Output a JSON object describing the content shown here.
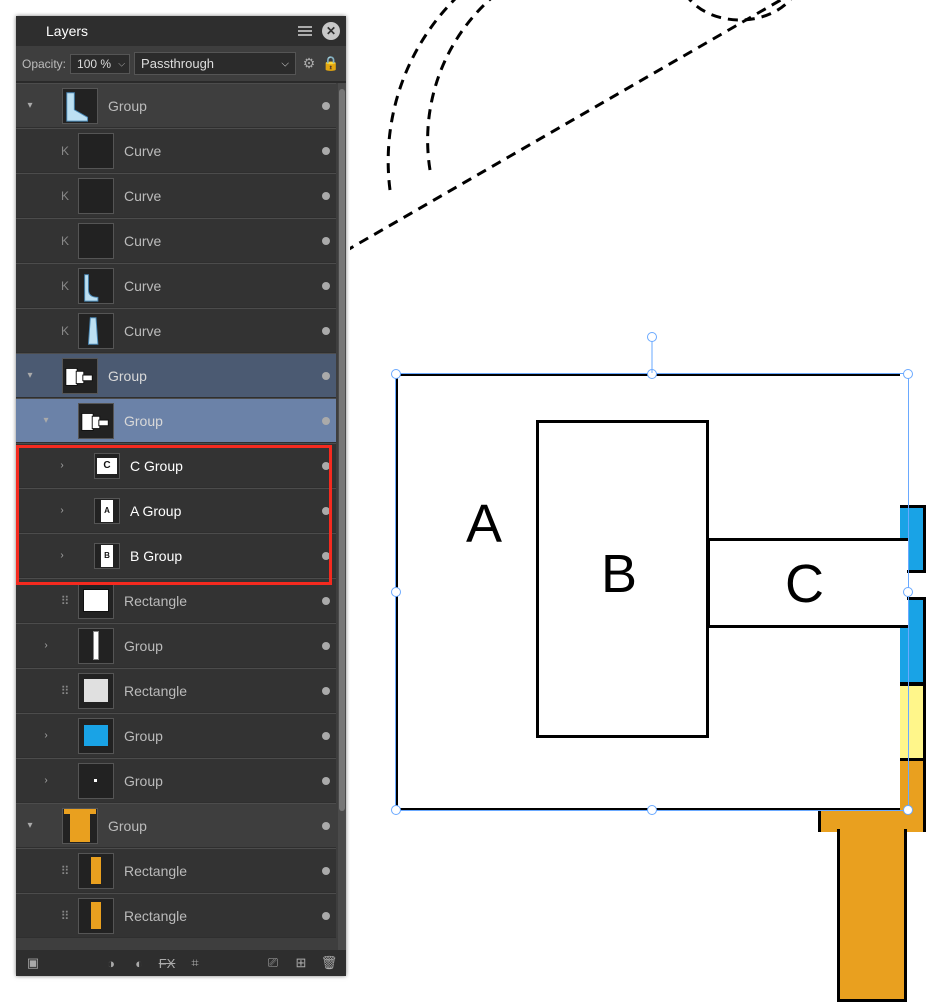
{
  "panel": {
    "title": "Layers",
    "opacity_label": "Opacity:",
    "opacity_value": "100 %",
    "blend_mode": "Passthrough"
  },
  "layers": [
    {
      "id": "grp0",
      "depth": 0,
      "kind": "group",
      "label": "Group",
      "expander": "▾",
      "sel": "",
      "thumb": {
        "type": "boot"
      },
      "icon": ""
    },
    {
      "id": "cv1",
      "depth": 1,
      "kind": "curve",
      "label": "Curve",
      "expander": "",
      "sel": "dark",
      "thumb": {
        "type": "blank"
      },
      "icon": "K"
    },
    {
      "id": "cv2",
      "depth": 1,
      "kind": "curve",
      "label": "Curve",
      "expander": "",
      "sel": "dark",
      "thumb": {
        "type": "blank"
      },
      "icon": "K"
    },
    {
      "id": "cv3",
      "depth": 1,
      "kind": "curve",
      "label": "Curve",
      "expander": "",
      "sel": "dark",
      "thumb": {
        "type": "blank"
      },
      "icon": "K"
    },
    {
      "id": "cv4",
      "depth": 1,
      "kind": "curve",
      "label": "Curve",
      "expander": "",
      "sel": "dark",
      "thumb": {
        "type": "curve-lb"
      },
      "icon": "K"
    },
    {
      "id": "cv5",
      "depth": 1,
      "kind": "curve",
      "label": "Curve",
      "expander": "",
      "sel": "dark",
      "thumb": {
        "type": "curve-lb2"
      },
      "icon": "K"
    },
    {
      "id": "grp1",
      "depth": 0,
      "kind": "group",
      "label": "Group",
      "expander": "▾",
      "sel": "sel1",
      "thumb": {
        "type": "abc"
      },
      "icon": ""
    },
    {
      "id": "grp2",
      "depth": 1,
      "kind": "group",
      "label": "Group",
      "expander": "▾",
      "sel": "sel2",
      "thumb": {
        "type": "abc2"
      },
      "icon": ""
    },
    {
      "id": "cgrp",
      "depth": 2,
      "kind": "group",
      "label": "C Group",
      "expander": "›",
      "sel": "child-row",
      "thumb": {
        "type": "letter",
        "text": "C",
        "shape": "wide"
      },
      "icon": "",
      "white": true
    },
    {
      "id": "agrp",
      "depth": 2,
      "kind": "group",
      "label": "A Group",
      "expander": "›",
      "sel": "child-row",
      "thumb": {
        "type": "letter",
        "text": "A",
        "shape": "tall"
      },
      "icon": "",
      "white": true
    },
    {
      "id": "bgrp",
      "depth": 2,
      "kind": "group",
      "label": "B Group",
      "expander": "›",
      "sel": "child-row",
      "thumb": {
        "type": "letter",
        "text": "B",
        "shape": "tall"
      },
      "icon": "",
      "white": true
    },
    {
      "id": "rect1",
      "depth": 1,
      "kind": "rect",
      "label": "Rectangle",
      "expander": "",
      "sel": "dark",
      "thumb": {
        "type": "rect-w"
      },
      "icon": "⠿"
    },
    {
      "id": "grp3",
      "depth": 1,
      "kind": "group",
      "label": "Group",
      "expander": "›",
      "sel": "dark",
      "thumb": {
        "type": "thin"
      },
      "icon": ""
    },
    {
      "id": "rect2",
      "depth": 1,
      "kind": "rect",
      "label": "Rectangle",
      "expander": "",
      "sel": "dark",
      "thumb": {
        "type": "rect-light"
      },
      "icon": "⠿"
    },
    {
      "id": "grp4",
      "depth": 1,
      "kind": "group",
      "label": "Group",
      "expander": "›",
      "sel": "dark",
      "thumb": {
        "type": "rect-blue"
      },
      "icon": ""
    },
    {
      "id": "grp5",
      "depth": 1,
      "kind": "group",
      "label": "Group",
      "expander": "›",
      "sel": "dark",
      "thumb": {
        "type": "dot"
      },
      "icon": ""
    },
    {
      "id": "grp6",
      "depth": 0,
      "kind": "group",
      "label": "Group",
      "expander": "▾",
      "sel": "",
      "thumb": {
        "type": "orange-t"
      },
      "icon": ""
    },
    {
      "id": "rect3",
      "depth": 1,
      "kind": "rect",
      "label": "Rectangle",
      "expander": "",
      "sel": "dark",
      "thumb": {
        "type": "orange-bar"
      },
      "icon": "⠿"
    },
    {
      "id": "rect4",
      "depth": 1,
      "kind": "rect",
      "label": "Rectangle",
      "expander": "",
      "sel": "dark",
      "thumb": {
        "type": "orange-bar"
      },
      "icon": "⠿"
    }
  ],
  "canvas": {
    "letters": {
      "a": "A",
      "b": "B",
      "c": "C"
    }
  }
}
